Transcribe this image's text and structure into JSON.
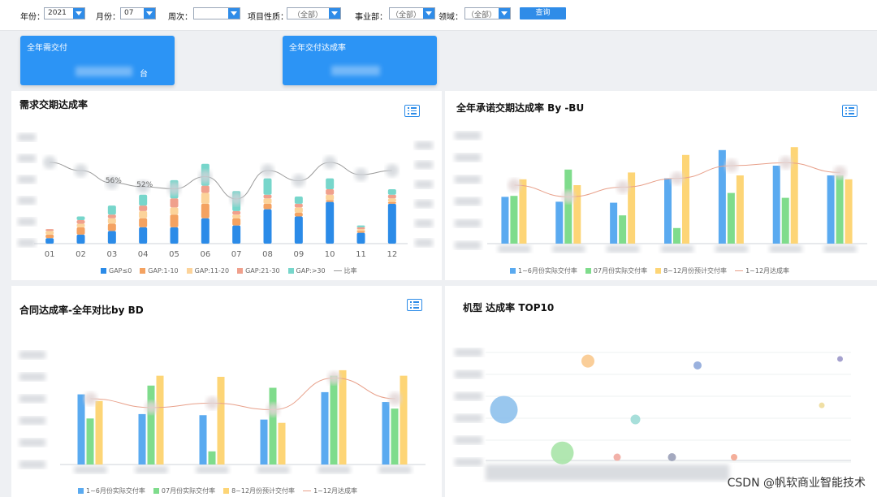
{
  "filters": {
    "year_label": "年份：",
    "year_value": "2021",
    "month_label": "月份：",
    "month_value": "07",
    "week_label": "周次：",
    "week_value": "",
    "project_label": "项目性质：",
    "project_value": "（全部）",
    "bu_label": "事业部：",
    "bu_value": "（全部）",
    "field_label": "领域：",
    "field_value": "（全部）",
    "query_label": "查询"
  },
  "kpis": [
    {
      "title": "全年需交付",
      "unit": "台"
    },
    {
      "title": "全年交付达成率"
    }
  ],
  "colors": {
    "accent": "#2c94f5",
    "blue": "#5aaaf0",
    "green": "#7fdc8c",
    "yellow": "#fdd576",
    "orange": "#f4a261",
    "line": "#e8a08a"
  },
  "panels": {
    "p1": {
      "title": "需求交期达成率",
      "icon": "list-icon"
    },
    "p2": {
      "title": "全年承诺交期达成率 By -BU",
      "icon": "list-icon"
    },
    "p3": {
      "title": "合同达成率-全年对比by BD",
      "icon": "list-icon"
    },
    "p4": {
      "title": "机型 达成率 TOP10"
    }
  },
  "chart_data": [
    {
      "type": "bar",
      "title": "需求交期达成率",
      "categories": [
        "01",
        "02",
        "03",
        "04",
        "05",
        "06",
        "07",
        "08",
        "09",
        "10",
        "11",
        "12"
      ],
      "stacked": true,
      "series": [
        {
          "name": "GAP≤0",
          "values": [
            3,
            5,
            7,
            9,
            9,
            14,
            10,
            19,
            15,
            23,
            6,
            22
          ]
        },
        {
          "name": "GAP:1-10",
          "values": [
            2,
            4,
            4,
            5,
            7,
            8,
            4,
            3,
            2,
            1,
            1,
            1
          ]
        },
        {
          "name": "GAP:11-20",
          "values": [
            2,
            2,
            3,
            4,
            4,
            6,
            2,
            3,
            3,
            3,
            1,
            2
          ]
        },
        {
          "name": "GAP:21-30",
          "values": [
            1,
            2,
            2,
            3,
            5,
            4,
            2,
            2,
            2,
            3,
            1,
            2
          ]
        },
        {
          "name": "GAP:>30",
          "values": [
            0,
            2,
            5,
            6,
            10,
            12,
            11,
            9,
            4,
            6,
            1,
            3
          ]
        }
      ],
      "line": {
        "name": "比率",
        "values": [
          76,
          68,
          56,
          52,
          50,
          62,
          40,
          68,
          58,
          76,
          64,
          68
        ]
      },
      "data_labels": {
        "03": "56%",
        "04": "52%"
      },
      "legend": "bottom"
    },
    {
      "type": "bar",
      "title": "全年承诺交期达成率 By -BU",
      "series": [
        {
          "name": "1~6月份实际交付率",
          "values": [
            48,
            43,
            42,
            67,
            96,
            80,
            70
          ]
        },
        {
          "name": "07月份实际交付率",
          "values": [
            49,
            76,
            29,
            16,
            52,
            47,
            70
          ]
        },
        {
          "name": "8~12月份预计交付率",
          "values": [
            66,
            60,
            73,
            91,
            70,
            99,
            66
          ]
        }
      ],
      "line": {
        "name": "1~12月达成率",
        "values": [
          60,
          48,
          58,
          67,
          80,
          83,
          73
        ]
      },
      "legend": "bottom"
    },
    {
      "type": "bar",
      "title": "合同达成率-全年对比by BD",
      "series": [
        {
          "name": "1~6月份实际交付率",
          "values": [
            64,
            46,
            45,
            41,
            66,
            57
          ]
        },
        {
          "name": "07月份实际交付率",
          "values": [
            42,
            72,
            12,
            70,
            81,
            51
          ]
        },
        {
          "name": "8~12月份预计交付率",
          "values": [
            58,
            81,
            80,
            38,
            86,
            81
          ]
        }
      ],
      "line": {
        "name": "1~12月达成率",
        "values": [
          60,
          52,
          56,
          50,
          79,
          60
        ]
      },
      "legend": "bottom"
    },
    {
      "type": "scatter",
      "title": "机型 达成率 TOP10",
      "points": [
        {
          "x": 0.05,
          "y": 0.53,
          "size": 34,
          "color": "#8ec1ec"
        },
        {
          "x": 0.21,
          "y": 0.93,
          "size": 28,
          "color": "#a8e4a8"
        },
        {
          "x": 0.28,
          "y": 0.08,
          "size": 16,
          "color": "#f9c98e"
        },
        {
          "x": 0.58,
          "y": 0.12,
          "size": 10,
          "color": "#8fa9da"
        },
        {
          "x": 0.41,
          "y": 0.62,
          "size": 12,
          "color": "#9ddbd6"
        },
        {
          "x": 0.92,
          "y": 0.49,
          "size": 7,
          "color": "#eedc9a"
        },
        {
          "x": 0.97,
          "y": 0.06,
          "size": 7,
          "color": "#9b97c9"
        },
        {
          "x": 0.36,
          "y": 0.97,
          "size": 9,
          "color": "#f1a8a0"
        },
        {
          "x": 0.51,
          "y": 0.97,
          "size": 10,
          "color": "#9aa0b8"
        },
        {
          "x": 0.68,
          "y": 0.97,
          "size": 8,
          "color": "#f3a58f"
        }
      ]
    }
  ],
  "watermark": "CSDN @帆软商业智能技术"
}
